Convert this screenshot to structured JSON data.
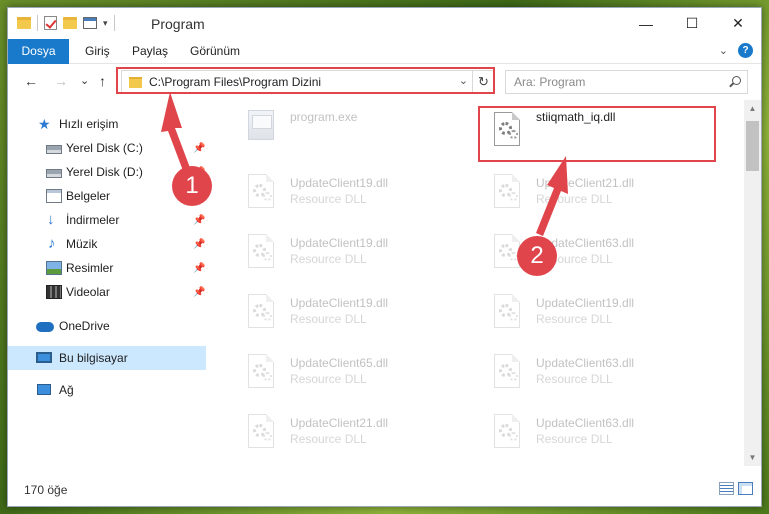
{
  "window": {
    "title": "Program",
    "controls": {
      "minimize": "—",
      "maximize": "☐",
      "close": "✕"
    }
  },
  "ribbon": {
    "tabs": [
      "Dosya",
      "Giriş",
      "Paylaş",
      "Görünüm"
    ],
    "help": "?"
  },
  "nav": {
    "back": "←",
    "forward": "→",
    "recent": "⌄",
    "up": "↑",
    "address": "C:\\Program Files\\Program Dizini",
    "refresh": "↻",
    "search_placeholder": "Ara: Program"
  },
  "sidebar": {
    "items": [
      {
        "label": "Hızlı erişim",
        "icon": "quick-access-icon",
        "pinned": false
      },
      {
        "label": "Yerel Disk (C:)",
        "icon": "drive-icon",
        "pinned": true
      },
      {
        "label": "Yerel Disk (D:)",
        "icon": "drive-icon",
        "pinned": true
      },
      {
        "label": "Belgeler",
        "icon": "documents-icon",
        "pinned": true
      },
      {
        "label": "İndirmeler",
        "icon": "downloads-icon",
        "pinned": true
      },
      {
        "label": "Müzik",
        "icon": "music-icon",
        "pinned": true
      },
      {
        "label": "Resimler",
        "icon": "pictures-icon",
        "pinned": true
      },
      {
        "label": "Videolar",
        "icon": "videos-icon",
        "pinned": true
      },
      {
        "label": "OneDrive",
        "icon": "onedrive-icon",
        "pinned": false
      },
      {
        "label": "Bu bilgisayar",
        "icon": "this-pc-icon",
        "pinned": false,
        "selected": true
      },
      {
        "label": "Ağ",
        "icon": "network-icon",
        "pinned": false
      }
    ]
  },
  "files": [
    {
      "name": "program.exe",
      "desc": "",
      "type": "exe",
      "faded": true
    },
    {
      "name": "stiiqmath_iq.dll",
      "desc": "",
      "type": "dll",
      "faded": false
    },
    {
      "name": "UpdateClient19.dll",
      "desc": "Resource DLL",
      "type": "dll",
      "faded": true
    },
    {
      "name": "UpdateClient21.dll",
      "desc": "Resource DLL",
      "type": "dll",
      "faded": true
    },
    {
      "name": "UpdateClient19.dll",
      "desc": "Resource DLL",
      "type": "dll",
      "faded": true
    },
    {
      "name": "UpdateClient63.dll",
      "desc": "Resource DLL",
      "type": "dll",
      "faded": true
    },
    {
      "name": "UpdateClient19.dll",
      "desc": "Resource DLL",
      "type": "dll",
      "faded": true
    },
    {
      "name": "UpdateClient19.dll",
      "desc": "Resource DLL",
      "type": "dll",
      "faded": true
    },
    {
      "name": "UpdateClient65.dll",
      "desc": "Resource DLL",
      "type": "dll",
      "faded": true
    },
    {
      "name": "UpdateClient63.dll",
      "desc": "Resource DLL",
      "type": "dll",
      "faded": true
    },
    {
      "name": "UpdateClient21.dll",
      "desc": "Resource DLL",
      "type": "dll",
      "faded": true
    },
    {
      "name": "UpdateClient63.dll",
      "desc": "Resource DLL",
      "type": "dll",
      "faded": true
    }
  ],
  "status": {
    "item_count": "170 öğe"
  },
  "annotations": {
    "color": "#e0454c",
    "badges": [
      "1",
      "2"
    ]
  }
}
